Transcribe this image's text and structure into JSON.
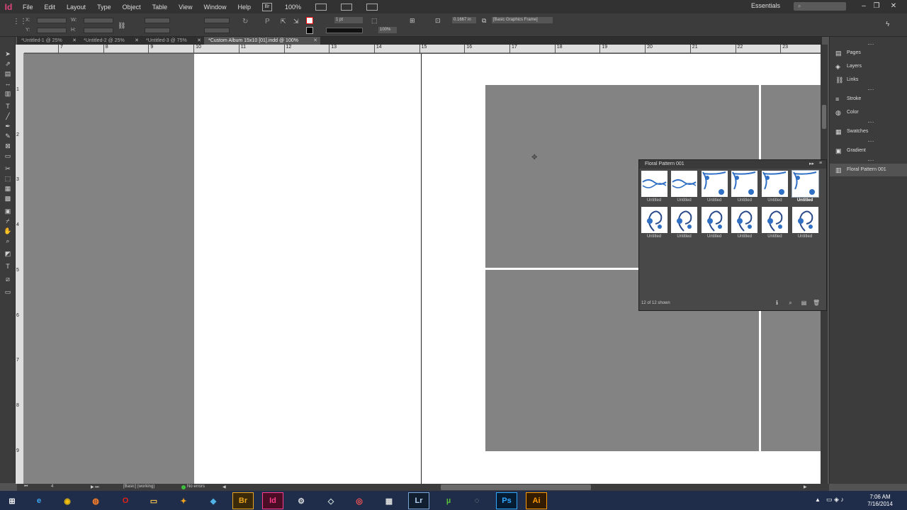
{
  "app": {
    "logo": "Id",
    "zoom": "100%",
    "bridge_badge": "Br"
  },
  "menu": [
    "File",
    "Edit",
    "Layout",
    "Type",
    "Object",
    "Table",
    "View",
    "Window",
    "Help"
  ],
  "workspace": "Essentials",
  "search_placeholder": "",
  "control": {
    "x_label": "X:",
    "y_label": "Y:",
    "w_label": "W:",
    "h_label": "H:",
    "stroke_weight": "1 pt",
    "scale_value": "0.1667 in",
    "percent": "100%",
    "object_style": "[Basic Graphics Frame]"
  },
  "tabs": [
    {
      "label": "*Untitled-1 @ 25%"
    },
    {
      "label": "*Untitled-2 @ 25%"
    },
    {
      "label": "*Untitled-3 @ 75%"
    },
    {
      "label": "*Custom Album 15x10 [01].indd @ 100%"
    }
  ],
  "ruler_h": [
    "7",
    "8",
    "9",
    "10",
    "11",
    "12",
    "13",
    "14",
    "15",
    "16",
    "17",
    "18",
    "19",
    "20",
    "21",
    "22",
    "23"
  ],
  "ruler_v": [
    "1",
    "2",
    "3",
    "4",
    "5",
    "6",
    "7",
    "8",
    "9"
  ],
  "library": {
    "title": "Floral Pattern 001",
    "items": [
      "Untitled",
      "Untitled",
      "Untitled",
      "Untitled",
      "Untitled",
      "Untitled",
      "Untitled",
      "Untitled",
      "Untitled",
      "Untitled",
      "Untitled",
      "Untitled"
    ],
    "selected_index": 5,
    "status": "12 of 12 shown"
  },
  "dock": [
    "Pages",
    "Layers",
    "Links",
    "Stroke",
    "Color",
    "Swatches",
    "Gradient",
    "Floral Pattern 001"
  ],
  "statusbar": {
    "page": "4",
    "master": "[Basic] (working)",
    "preflight": "No errors"
  },
  "taskbar": {
    "apps": [
      "Br",
      "Id",
      "Lr",
      "Ps",
      "Ai"
    ],
    "time": "7:06 AM",
    "date": "7/16/2014"
  },
  "colors": {
    "indesign": "#e0457b",
    "floral_blue": "#2f6fc4"
  }
}
